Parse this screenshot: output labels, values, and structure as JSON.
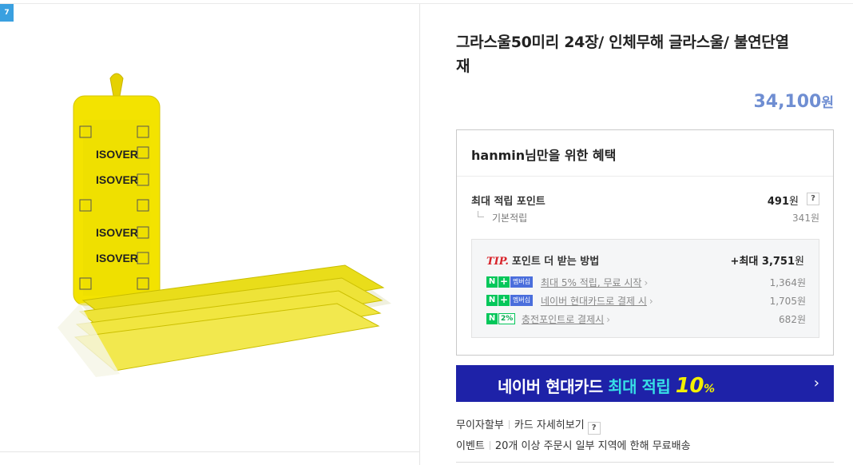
{
  "badge": "7",
  "product": {
    "title": "그라스울50미리 24장/ 인체무해 글라스울/ 불연단열재",
    "price": "34,100",
    "price_unit": "원",
    "image_label": "ISOVER"
  },
  "benefit": {
    "heading": "hanmin님만을 위한 혜택",
    "max_point_label": "최대 적립 포인트",
    "max_point_value": "491",
    "max_point_unit": "원",
    "help": "?",
    "basic_label": "기본적립",
    "basic_value": "341원",
    "tip": {
      "tip_word": "TIP.",
      "heading": "포인트 더 받는 방법",
      "total_prefix": "+최대",
      "total_value": "3,751",
      "total_unit": "원",
      "rows": [
        {
          "n": "N",
          "plus": "+",
          "badge": "멤버십",
          "text": "최대 5% 적립, 무료 시작",
          "value": "1,364원"
        },
        {
          "n": "N",
          "plus": "+",
          "badge": "멤버십",
          "text": "네이버 현대카드로 결제 시",
          "value": "1,705원"
        },
        {
          "n": "N",
          "badge": "2%",
          "text": "충전포인트로 결제시",
          "value": "682원"
        }
      ]
    }
  },
  "banner": {
    "part1": "네이버 현대카드",
    "part2": "최대 적립",
    "part3": "10",
    "part4": "%",
    "arrow": "›"
  },
  "extras": {
    "installment": "무이자할부",
    "card_detail": "카드 자세히보기",
    "help": "?",
    "event_label": "이벤트",
    "event_text": "20개 이상 주문시 일부 지역에 한해 무료배송"
  },
  "colors": {
    "price": "#6f8ed2",
    "banner_bg": "#1e22a8",
    "tip_red": "#d8232a",
    "naver_green": "#03c75a"
  }
}
